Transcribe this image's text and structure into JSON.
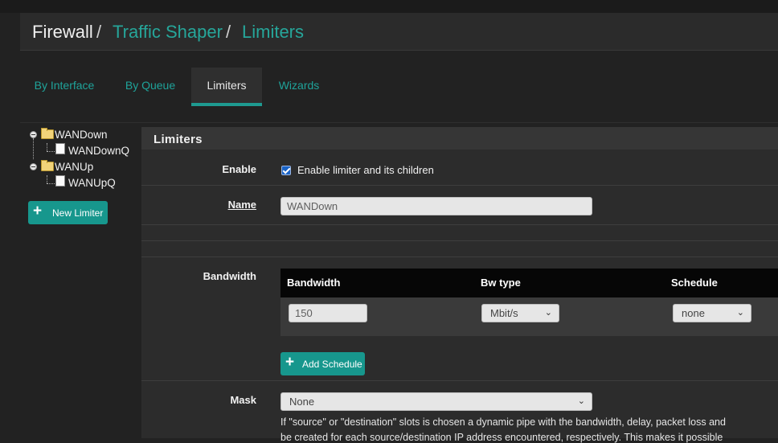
{
  "breadcrumb": {
    "root": "Firewall",
    "sep1": "/",
    "level2": "Traffic Shaper",
    "sep2": "/",
    "level3": "Limiters"
  },
  "tabs": [
    {
      "label": "By Interface",
      "active": false
    },
    {
      "label": "By Queue",
      "active": false
    },
    {
      "label": "Limiters",
      "active": true
    },
    {
      "label": "Wizards",
      "active": false
    }
  ],
  "tree": [
    {
      "label": "WANDown",
      "children": [
        "WANDownQ"
      ]
    },
    {
      "label": "WANUp",
      "children": [
        "WANUpQ"
      ]
    }
  ],
  "new_limiter_label": "New Limiter",
  "panel": {
    "title": "Limiters",
    "enable": {
      "label": "Enable",
      "checkbox_label": "Enable limiter and its children",
      "checked": true
    },
    "name": {
      "label": "Name",
      "value": "WANDown"
    },
    "bandwidth": {
      "label": "Bandwidth",
      "columns": [
        "Bandwidth",
        "Bw type",
        "Schedule"
      ],
      "row": {
        "bandwidth": "150",
        "bw_type": "Mbit/s",
        "schedule": "none"
      },
      "add_schedule_label": "Add Schedule"
    },
    "mask": {
      "label": "Mask",
      "value": "None",
      "help_line1": "If \"source\" or \"destination\" slots is chosen a dynamic pipe with the bandwidth, delay, packet loss and",
      "help_line2": "be created for each source/destination IP address encountered, respectively. This makes it possible"
    }
  },
  "colors": {
    "accent": "#1e9a90",
    "link": "#26a69a",
    "background": "#222222",
    "panel": "#2c2c2c",
    "table_header": "#060606"
  },
  "icons": {
    "expander": "minus-circle-icon",
    "folder": "folder-open-icon",
    "document": "document-icon",
    "add": "plus-icon",
    "dropdown": "chevron-down-icon"
  }
}
